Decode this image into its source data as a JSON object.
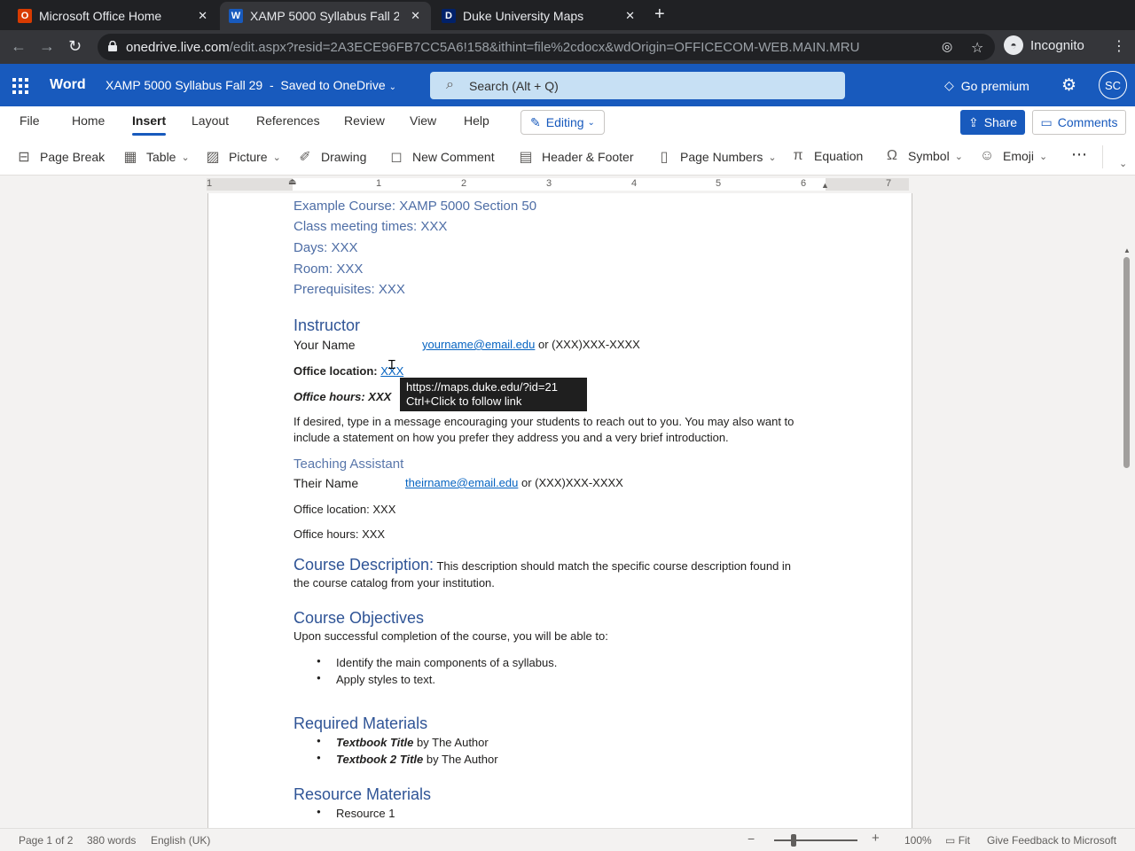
{
  "browser": {
    "tabs": [
      {
        "title": "Microsoft Office Home",
        "favicon": "office-icon",
        "favicon_color": "#d83b01"
      },
      {
        "title": "XAMP 5000 Syllabus Fall 29",
        "favicon": "word-icon",
        "favicon_color": "#185abd"
      },
      {
        "title": "Duke University Maps",
        "favicon": "duke-icon",
        "favicon_color": "#012169"
      }
    ],
    "url_host": "onedrive.live.com",
    "url_path": "/edit.aspx?resid=2A3ECE96FB7CC5A6!158&ithint=file%2cdocx&wdOrigin=OFFICECOM-WEB.MAIN.MRU",
    "profile": "Incognito"
  },
  "app": {
    "name": "Word",
    "doc_title": "XAMP 5000 Syllabus Fall 29",
    "saved_status": "Saved to OneDrive",
    "search_placeholder": "Search (Alt + Q)",
    "premium": "Go premium",
    "user_initials": "SC",
    "brand_color": "#185abd"
  },
  "ribbon": {
    "tabs": [
      "File",
      "Home",
      "Insert",
      "Layout",
      "References",
      "Review",
      "View",
      "Help"
    ],
    "active_tab": "Insert",
    "editing": "Editing",
    "share": "Share",
    "comments": "Comments",
    "commands": {
      "page_break": "Page Break",
      "table": "Table",
      "picture": "Picture",
      "drawing": "Drawing",
      "new_comment": "New Comment",
      "header_footer": "Header & Footer",
      "page_numbers": "Page Numbers",
      "equation": "Equation",
      "symbol": "Symbol",
      "emoji": "Emoji"
    }
  },
  "ruler": {
    "numbers": [
      "1",
      "1",
      "2",
      "3",
      "4",
      "5",
      "6",
      "7"
    ]
  },
  "document": {
    "course": "Example Course: XAMP 5000 Section 50",
    "meeting": "Class meeting times: XXX",
    "days": "Days: XXX",
    "room": "Room: XXX",
    "prereq": "Prerequisites: XXX",
    "instructor_heading": "Instructor",
    "instructor_name": "Your Name",
    "instructor_email": "yourname@email.edu",
    "instructor_phone": " or (XXX)XXX-XXXX",
    "office_location_label": "Office location: ",
    "office_location_value": "XXX",
    "office_hours": "Office hours: XXX",
    "message_line1": "If desired, type in a message encouraging your students to reach out to you. You may also want to",
    "message_line2": "include a statement on how you prefer they address you and a very brief introduction.",
    "ta_heading": "Teaching Assistant",
    "ta_name": "Their Name",
    "ta_email": "theirname@email.edu",
    "ta_phone": " or (XXX)XXX-XXXX",
    "ta_location": "Office location: XXX",
    "ta_hours": "Office hours: XXX",
    "desc_heading": "Course Description:",
    "desc_line1": " This description should match the specific course description found in",
    "desc_line2": "the course catalog from your institution.",
    "obj_heading": "Course Objectives",
    "obj_intro": "Upon successful completion of the course, you will be able to:",
    "objectives": [
      "Identify the main components of a syllabus.",
      "Apply styles to text."
    ],
    "req_heading": "Required Materials",
    "textbooks": [
      {
        "title": "Textbook Title",
        "by": " by The Author"
      },
      {
        "title": "Textbook 2 Title",
        "by": " by The Author"
      }
    ],
    "res_heading": "Resource Materials",
    "resources": [
      "Resource 1"
    ],
    "tooltip_url": "https://maps.duke.edu/?id=21",
    "tooltip_hint": "Ctrl+Click to follow link"
  },
  "status": {
    "page": "Page 1 of 2",
    "words": "380 words",
    "language": "English (UK)",
    "zoom": "100%",
    "fit": "Fit",
    "feedback": "Give Feedback to Microsoft"
  }
}
